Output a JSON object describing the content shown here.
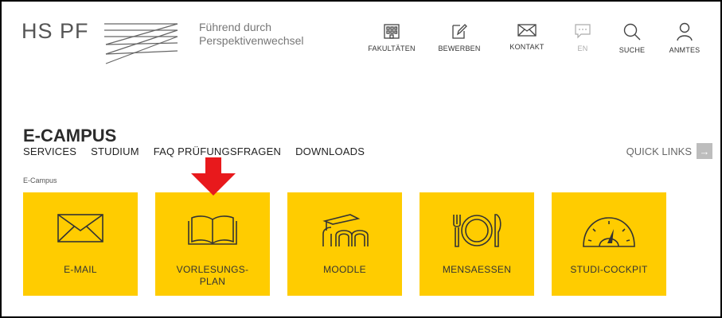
{
  "header": {
    "logo": "HS PF",
    "tagline_line1": "Führend durch",
    "tagline_line2": "Perspektivenwechsel",
    "nav": [
      {
        "label": "FAKULTÄTEN",
        "icon": "building-icon"
      },
      {
        "label": "BEWERBEN",
        "icon": "pen-paper-icon"
      },
      {
        "label": "KONTAKT",
        "icon": "envelope-icon"
      },
      {
        "label": "EN",
        "icon": "speech-bubble-icon"
      },
      {
        "label": "SUCHE",
        "icon": "search-icon"
      },
      {
        "label": "ANMTES",
        "icon": "user-icon"
      }
    ]
  },
  "page": {
    "title": "E-CAMPUS",
    "subnav": [
      "SERVICES",
      "STUDIUM",
      "FAQ PRÜFUNGSFRAGEN",
      "DOWNLOADS"
    ],
    "quick_links": "QUICK LINKS",
    "quick_links_arrow": "→",
    "breadcrumb": "E-Campus"
  },
  "tiles": [
    {
      "label": "E-MAIL",
      "icon": "envelope-icon"
    },
    {
      "label_line1": "VORLESUNGS-",
      "label_line2": "PLAN",
      "icon": "open-book-icon"
    },
    {
      "label": "MOODLE",
      "icon": "moodle-icon"
    },
    {
      "label": "MENSAESSEN",
      "icon": "plate-cutlery-icon"
    },
    {
      "label": "STUDI-COCKPIT",
      "icon": "gauge-icon"
    }
  ],
  "colors": {
    "tile": "#ffcc00",
    "arrow": "#e8191c",
    "quick_links_box": "#bdbdbd"
  }
}
